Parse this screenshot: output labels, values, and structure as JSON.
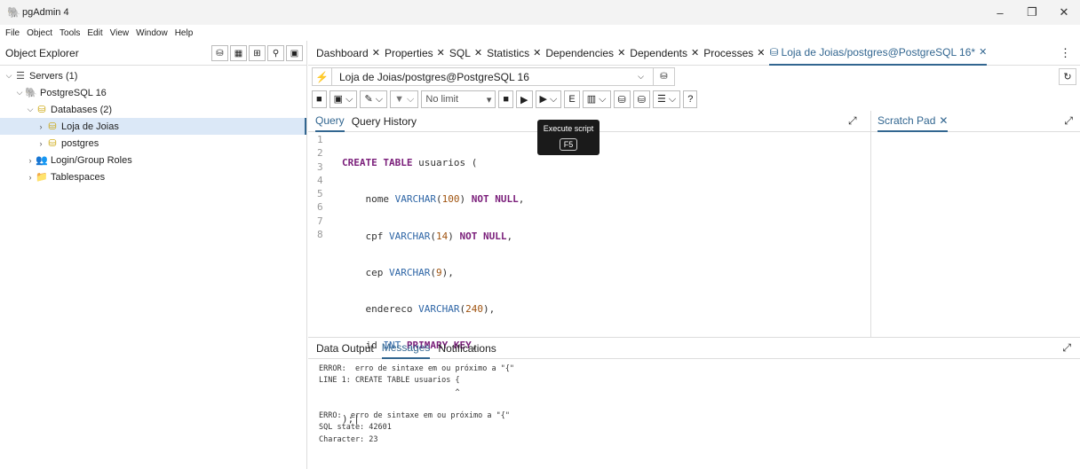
{
  "window": {
    "title": "pgAdmin 4"
  },
  "menu": [
    "File",
    "Object",
    "Tools",
    "Edit",
    "View",
    "Window",
    "Help"
  ],
  "object_explorer": {
    "title": "Object Explorer",
    "tree": [
      {
        "label": "Servers (1)",
        "icon": "servers-icon",
        "level": 0
      },
      {
        "label": "PostgreSQL 16",
        "icon": "elephant-icon",
        "level": 1
      },
      {
        "label": "Databases (2)",
        "icon": "databases-icon",
        "level": 2
      },
      {
        "label": "Loja de Joias",
        "icon": "database-icon",
        "level": 3,
        "selected": true
      },
      {
        "label": "postgres",
        "icon": "database-icon",
        "level": 3
      },
      {
        "label": "Login/Group Roles",
        "icon": "roles-icon",
        "level": 2
      },
      {
        "label": "Tablespaces",
        "icon": "folder-icon",
        "level": 2
      }
    ]
  },
  "tabs": [
    "Dashboard",
    "Properties",
    "SQL",
    "Statistics",
    "Dependencies",
    "Dependents",
    "Processes",
    "Loja de Joias/postgres@PostgreSQL 16*"
  ],
  "active_tab": "Loja de Joias/postgres@PostgreSQL 16*",
  "connection": "Loja de Joias/postgres@PostgreSQL 16",
  "toolbar": {
    "limit": "No limit",
    "tooltip_title": "Execute script",
    "tooltip_key": "F5"
  },
  "query_tabs": [
    "Query",
    "Query History"
  ],
  "scratch_pad": "Scratch Pad",
  "editor": {
    "line_numbers": [
      "1",
      "2",
      "3",
      "4",
      "5",
      "6",
      "7",
      "8"
    ]
  },
  "output_tabs": [
    "Data Output",
    "Messages",
    "Notifications"
  ],
  "active_output_tab": "Messages",
  "messages": [
    "ERROR:  erro de sintaxe em ou próximo a \"{\"",
    "LINE 1: CREATE TABLE usuarios {",
    "                              ^",
    "",
    "ERRO:  erro de sintaxe em ou próximo a \"{\"",
    "SQL state: 42601",
    "Character: 23"
  ],
  "colors": {
    "accent": "#326690",
    "keyword": "#7a1e7a",
    "type": "#2f66a6",
    "number": "#a0530f"
  }
}
